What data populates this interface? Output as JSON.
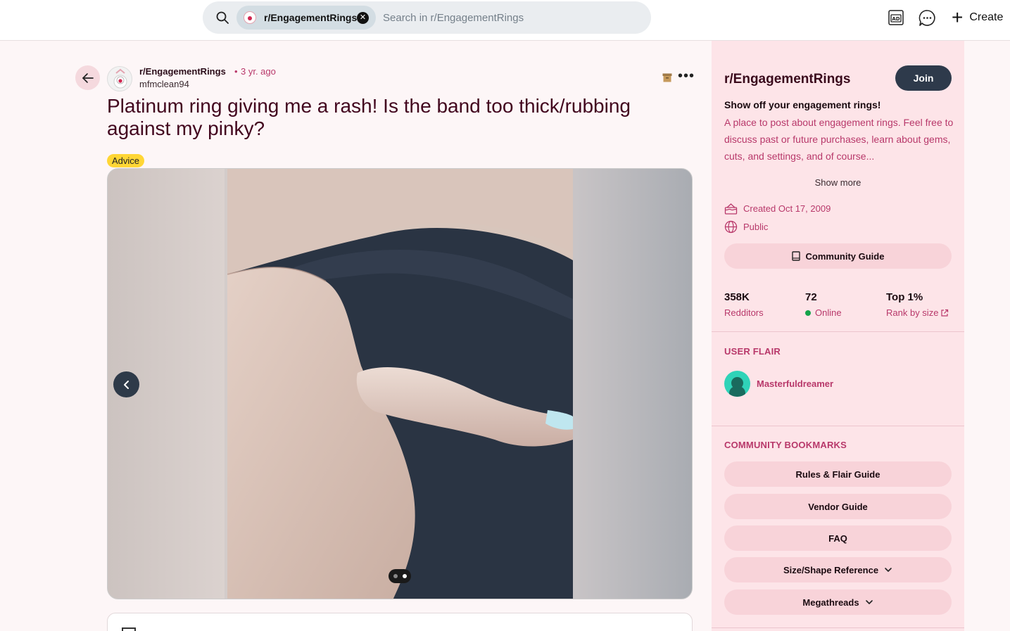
{
  "header": {
    "search_chip_label": "r/EngagementRings",
    "search_placeholder": "Search in r/EngagementRings",
    "create_label": "Create"
  },
  "post": {
    "subreddit": "r/EngagementRings",
    "separator": "•",
    "age": "3 yr. ago",
    "author": "mfmclean94",
    "title": "Platinum ring giving me a rash! Is the band too thick/rubbing against my pinky?",
    "flair": "Advice",
    "gallery": {
      "image_count": 2,
      "active_index": 1
    }
  },
  "sidebar": {
    "title": "r/EngagementRings",
    "join_label": "Join",
    "tagline": "Show off your engagement rings!",
    "description": "A place to post about engagement rings. Feel free to discuss past or future purchases, learn about gems, cuts, and settings, and of course...",
    "show_more": "Show more",
    "created": "Created Oct 17, 2009",
    "visibility": "Public",
    "community_guide": "Community Guide",
    "stats": [
      {
        "value": "358K",
        "label": "Redditors"
      },
      {
        "value": "72",
        "label": "Online"
      },
      {
        "value": "Top 1%",
        "label": "Rank by size"
      }
    ],
    "user_flair_heading": "USER FLAIR",
    "user_flair_name": "Masterfuldreamer",
    "bookmarks_heading": "COMMUNITY BOOKMARKS",
    "bookmarks": [
      "Rules & Flair Guide",
      "Vendor Guide",
      "FAQ",
      "Size/Shape Reference",
      "Megathreads"
    ]
  },
  "colors": {
    "accent": "#b8386a",
    "title": "#42061e",
    "join_button": "#2e3a4b",
    "flair": "#ffd635",
    "sidebar_bg": "#fde4e8"
  }
}
